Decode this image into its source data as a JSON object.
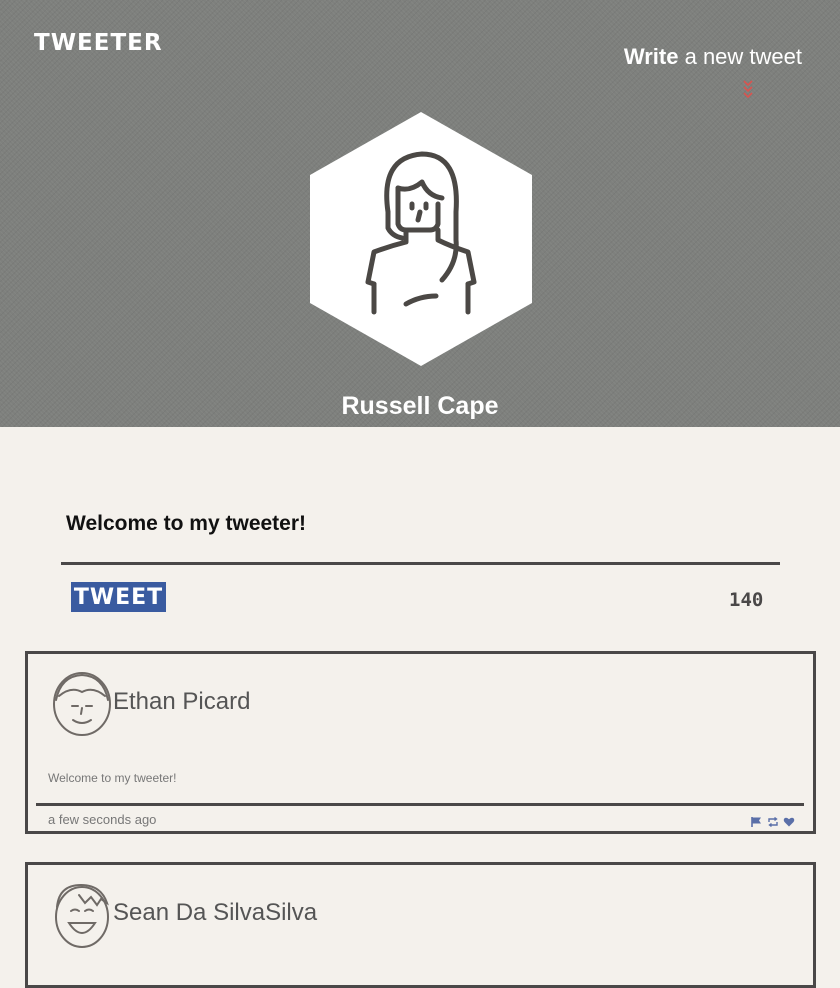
{
  "brand": "TWEETER",
  "header": {
    "compose_bold": "Write",
    "compose_rest": " a new tweet",
    "profile_name": "Russell Cape"
  },
  "composer": {
    "prompt": "Welcome to my tweeter!",
    "button_label": "TWEET",
    "counter": "140"
  },
  "tweets": [
    {
      "author": "Ethan Picard",
      "text": "Welcome to my tweeter!",
      "time": "a few seconds ago",
      "actions": [
        "flag-icon",
        "retweet-icon",
        "heart-icon"
      ]
    },
    {
      "author": "Sean Da SilvaSilva"
    }
  ],
  "colors": {
    "header_bg": "#7e807d",
    "page_bg": "#f4f1ec",
    "accent_blue": "#3a5ba0",
    "chevron_red": "#d9534f",
    "border": "#4a4848",
    "icon_blue": "#5a6fa8"
  }
}
